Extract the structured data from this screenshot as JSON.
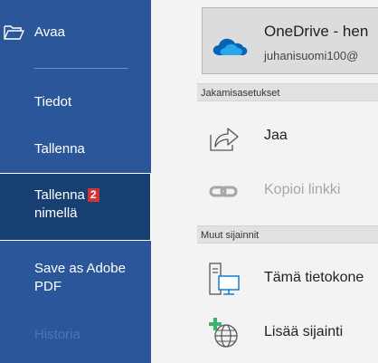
{
  "sidebar": {
    "open_label": "Avaa",
    "items": [
      {
        "label": "Tiedot"
      },
      {
        "label": "Tallenna"
      },
      {
        "label_line1": "Tallenna",
        "badge": "2",
        "label_line2": "nimellä"
      },
      {
        "label_line1": "Save as Adobe",
        "label_line2": "PDF"
      },
      {
        "label": "Historia"
      }
    ]
  },
  "main": {
    "onedrive": {
      "title": "OneDrive - hen",
      "subtitle": "juhanisuomi100@"
    },
    "sharing_header": "Jakamisasetukset",
    "share_label": "Jaa",
    "copy_link_label": "Kopioi linkki",
    "other_header": "Muut sijainnit",
    "this_pc_label": "Tämä tietokone",
    "add_location_label": "Lisää sijainti"
  },
  "colors": {
    "sidebar_bg": "#2b579a",
    "selected_bg": "#173f72",
    "badge": "#d13438",
    "onedrive_blue": "#0364b8"
  }
}
